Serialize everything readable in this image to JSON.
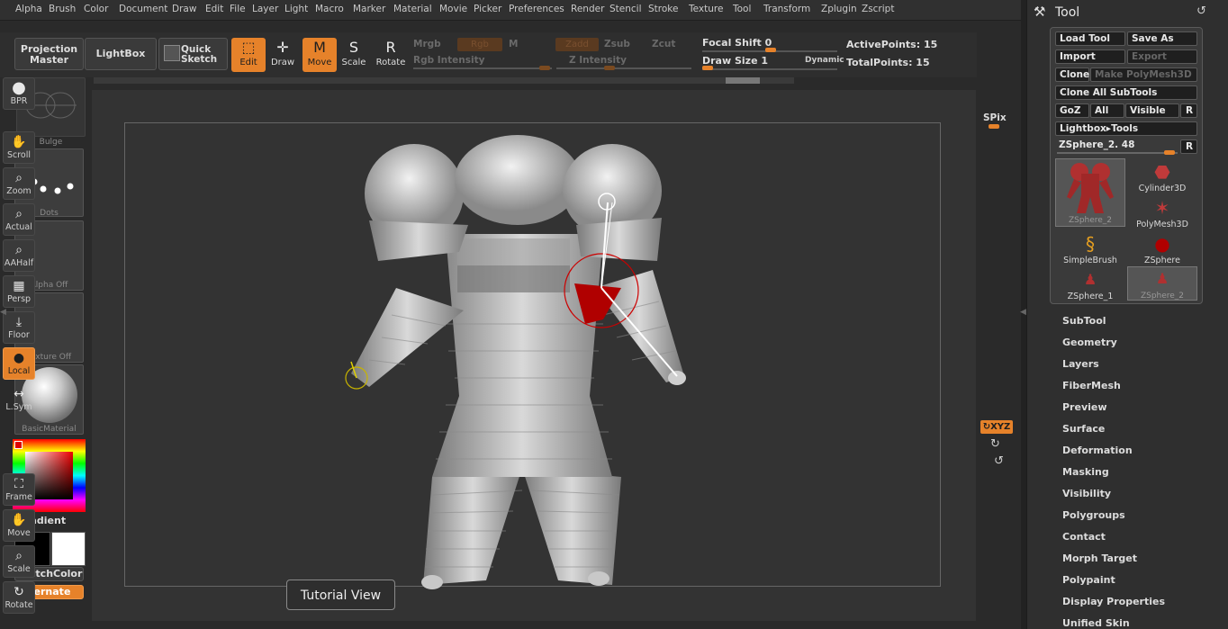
{
  "menu": [
    "Alpha",
    "Brush",
    "Color",
    "Document",
    "Draw",
    "Edit",
    "File",
    "Layer",
    "Light",
    "Macro",
    "Marker",
    "Material",
    "Movie",
    "Picker",
    "Preferences",
    "Render",
    "Stencil",
    "Stroke",
    "Texture",
    "Tool",
    "Transform",
    "Zplugin",
    "Zscript"
  ],
  "toolbar": {
    "projection_master": "Projection Master",
    "lightbox": "LightBox",
    "quick_sketch": "Quick Sketch",
    "edit": "Edit",
    "draw": "Draw",
    "move": "Move",
    "scale": "Scale",
    "rotate": "Rotate",
    "mrgb": "Mrgb",
    "rgb": "Rgb",
    "m": "M",
    "zadd": "Zadd",
    "zsub": "Zsub",
    "zcut": "Zcut",
    "rgb_intensity": "Rgb Intensity",
    "z_intensity": "Z Intensity",
    "focal_shift_label": "Focal Shift",
    "focal_shift_value": "0",
    "draw_size_label": "Draw Size",
    "draw_size_value": "1",
    "dynamic": "Dynamic",
    "active_points": "ActivePoints: 15",
    "total_points": "TotalPoints: 15"
  },
  "left_shelf": {
    "bulge": "Bulge",
    "dots": "Dots",
    "alpha_off": "Alpha Off",
    "texture_off": "Texture Off",
    "basic_material": "BasicMaterial",
    "gradient": "Gradient",
    "switchcolor": "SwitchColor",
    "alternate": "Alternate"
  },
  "canvas": {
    "tutorial_view": "Tutorial View"
  },
  "right_shelf": {
    "bpr": "BPR",
    "spix": "SPix",
    "scroll": "Scroll",
    "zoom": "Zoom",
    "actual": "Actual",
    "aahalf": "AAHalf",
    "persp": "Persp",
    "floor": "Floor",
    "local": "Local",
    "lsym": "L.Sym",
    "xyz": "XYZ",
    "frame": "Frame",
    "move": "Move",
    "scale": "Scale",
    "rotate": "Rotate"
  },
  "tool_panel": {
    "title": "Tool",
    "load_tool": "Load Tool",
    "save_as": "Save As",
    "import": "Import",
    "export": "Export",
    "clone": "Clone",
    "make_polymesh": "Make PolyMesh3D",
    "clone_all": "Clone All SubTools",
    "goz": "GoZ",
    "all": "All",
    "visible": "Visible",
    "r": "R",
    "lightbox_tools": "Lightbox▸Tools",
    "current_tool": "ZSphere_2. 48",
    "thumbs": [
      {
        "label": "ZSphere_2",
        "icon": "zsphere-figure-icon"
      },
      {
        "label": "Cylinder3D",
        "icon": "cylinder-icon"
      },
      {
        "label": "PolyMesh3D",
        "icon": "star-icon"
      },
      {
        "label": "SimpleBrush",
        "icon": "simplebrush-icon"
      },
      {
        "label": "ZSphere",
        "icon": "sphere-icon"
      },
      {
        "label": "ZSphere_1",
        "icon": "figure-icon"
      },
      {
        "label": "ZSphere_2",
        "icon": "figure-icon"
      }
    ],
    "sections": [
      "SubTool",
      "Geometry",
      "Layers",
      "FiberMesh",
      "Preview",
      "Surface",
      "Deformation",
      "Masking",
      "Visibility",
      "Polygroups",
      "Contact",
      "Morph Target",
      "Polypaint",
      "Display Properties",
      "Unified Skin"
    ]
  },
  "colors": {
    "accent": "#e6822a",
    "background": "#2a2a2a",
    "panel": "#2f2f2f"
  }
}
